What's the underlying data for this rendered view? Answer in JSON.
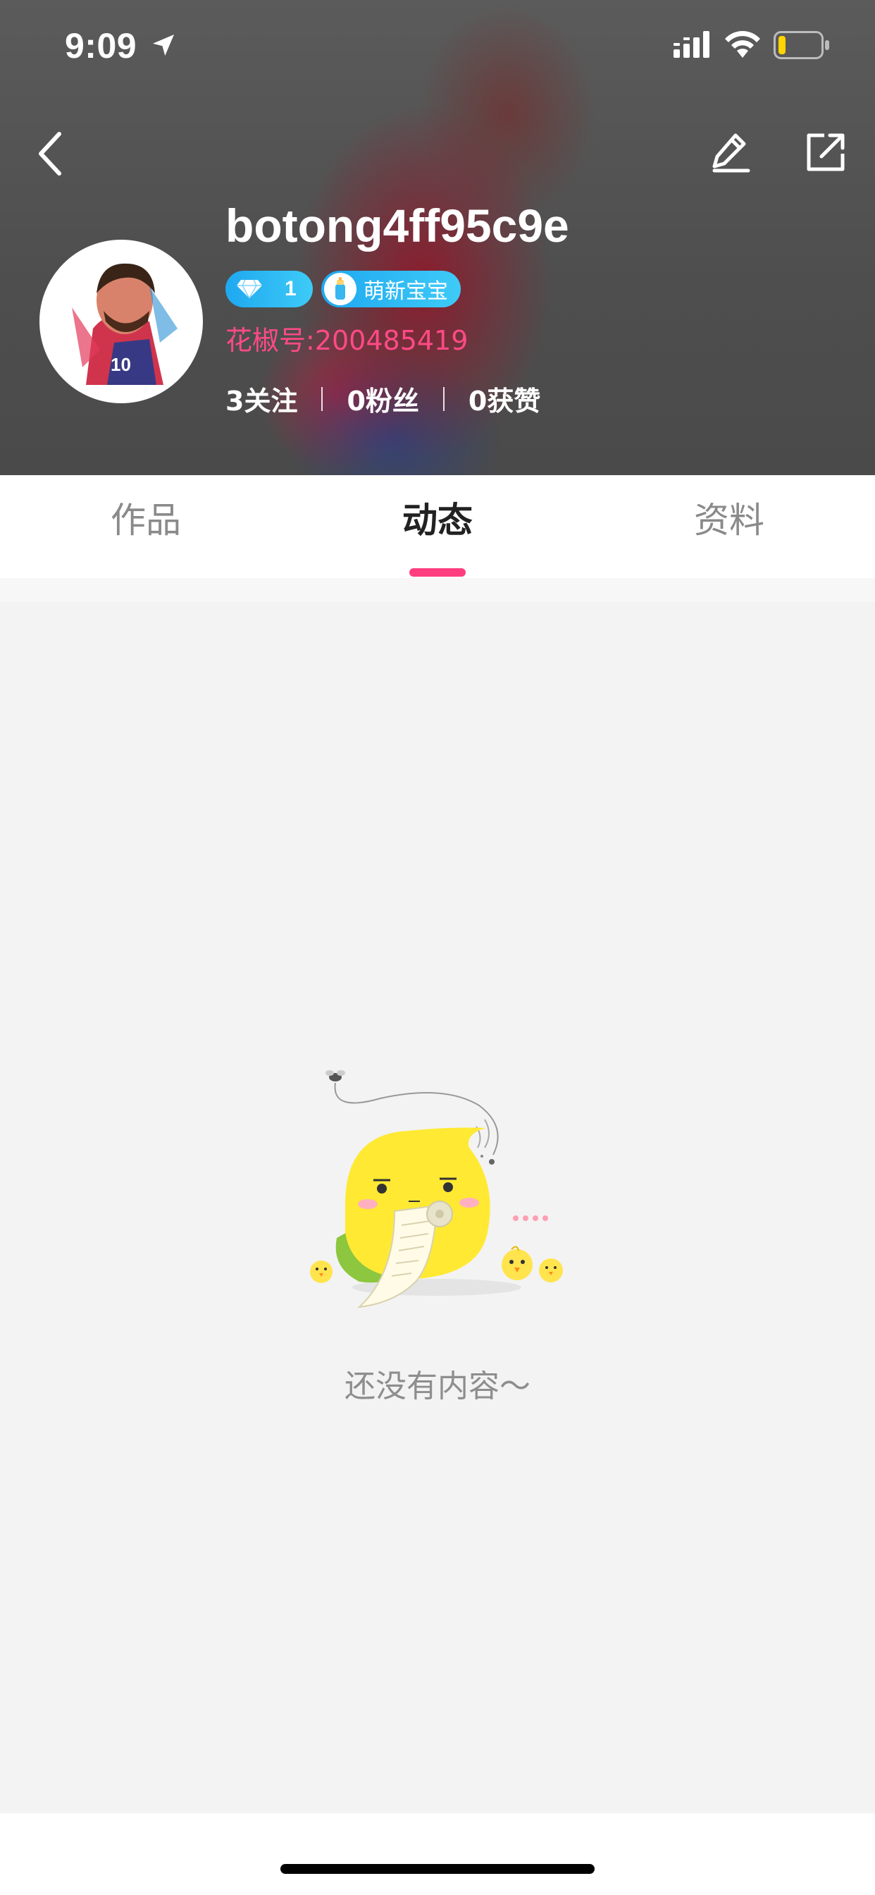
{
  "status_bar": {
    "time": "9:09",
    "icons": [
      "location-arrow-icon",
      "signal-icon",
      "wifi-icon",
      "battery-icon"
    ]
  },
  "nav": {
    "back_icon": "chevron-left-icon",
    "edit_icon": "pencil-icon",
    "share_icon": "share-external-icon"
  },
  "profile": {
    "username": "botong4ff95c9e",
    "level": "1",
    "title_badge": "萌新宝宝",
    "id_label": "花椒号:",
    "id_value": "200485419",
    "stats": {
      "following": "3关注",
      "fans": "0粉丝",
      "likes": "0获赞"
    }
  },
  "tabs": [
    {
      "label": "作品",
      "active": false
    },
    {
      "label": "动态",
      "active": true
    },
    {
      "label": "资料",
      "active": false
    }
  ],
  "empty_state": {
    "message": "还没有内容～"
  },
  "colors": {
    "accent_pink": "#ff3d7f",
    "id_pink": "#ff4a86",
    "badge_blue": "#1ea8f0",
    "background": "#f3f3f3"
  }
}
